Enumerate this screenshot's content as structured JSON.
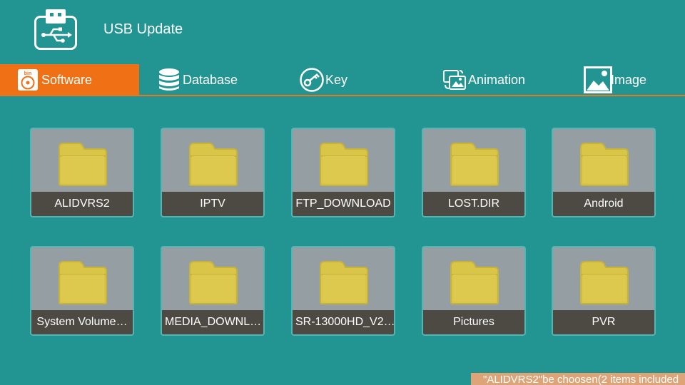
{
  "header": {
    "title": "USB Update",
    "icon": "usb-icon"
  },
  "tabs": [
    {
      "label": "Software",
      "icon": "bin-disc-icon",
      "active": true
    },
    {
      "label": "Database",
      "icon": "database-icon",
      "active": false
    },
    {
      "label": "Key",
      "icon": "key-icon",
      "active": false
    },
    {
      "label": "Animation",
      "icon": "animation-icon",
      "active": false
    },
    {
      "label": "Image",
      "icon": "image-icon",
      "active": false
    }
  ],
  "folders": [
    {
      "name": "ALIDVRS2"
    },
    {
      "name": "IPTV"
    },
    {
      "name": "FTP_DOWNLOAD"
    },
    {
      "name": "LOST.DIR"
    },
    {
      "name": "Android"
    },
    {
      "name": "System Volume…"
    },
    {
      "name": "MEDIA_DOWNL…"
    },
    {
      "name": "SR-13000HD_V2…"
    },
    {
      "name": "Pictures"
    },
    {
      "name": "PVR"
    }
  ],
  "status": {
    "message": "\"ALIDVRS2\"be choosen(2 items included"
  },
  "colors": {
    "background": "#229593",
    "active_tab": "#ef7015",
    "tile": "#959fa3",
    "tile_label": "#4d4a44",
    "folder": "#d9c649",
    "status_bar": "#dda478"
  }
}
